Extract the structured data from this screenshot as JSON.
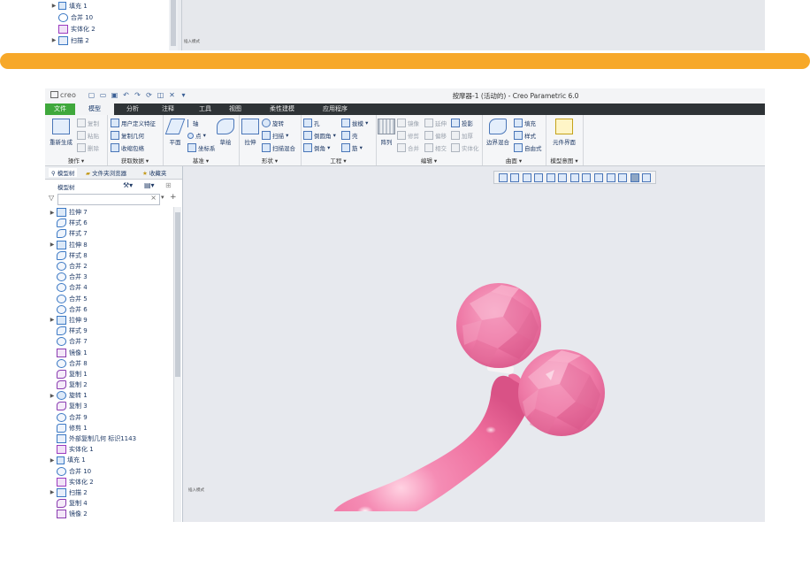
{
  "top_tree": {
    "items": [
      {
        "label": "填充 1",
        "expandable": true,
        "icon": "fill-icon"
      },
      {
        "label": "合并 10",
        "expandable": false,
        "icon": "merge-icon"
      },
      {
        "label": "实体化 2",
        "expandable": false,
        "icon": "solidify-icon"
      },
      {
        "label": "扫描 2",
        "expandable": true,
        "icon": "sweep-icon"
      }
    ],
    "status": "插入模式"
  },
  "app": {
    "logo": "creo",
    "window_title": "按摩器-1 (活动的) - Creo Parametric 6.0",
    "tabs": [
      {
        "label": "文件"
      },
      {
        "label": "模型"
      },
      {
        "label": "分析"
      },
      {
        "label": "注释"
      },
      {
        "label": "工具"
      },
      {
        "label": "视图"
      },
      {
        "label": "柔性建模"
      },
      {
        "label": "应用程序"
      }
    ],
    "ribbon": {
      "operations": {
        "label": "操作",
        "regenerate": "重新生成",
        "copy": "复制",
        "paste": "粘贴",
        "delete": "删除"
      },
      "get_data": {
        "label": "获取数据",
        "udf": "用户定义特征",
        "copy_geom": "复制几何",
        "shrinkwrap": "收缩包络"
      },
      "datum": {
        "label": "基准",
        "plane": "平面",
        "axis": "轴",
        "point": "点",
        "csys": "坐标系",
        "sketch": "草绘"
      },
      "shapes": {
        "label": "形状",
        "extrude": "拉伸",
        "revolve": "旋转",
        "sweep": "扫描",
        "swept_blend": "扫描混合"
      },
      "engineering": {
        "label": "工程",
        "hole": "孔",
        "round": "倒圆角",
        "chamfer": "倒角",
        "draft": "拔模",
        "shell": "壳",
        "rib": "筋"
      },
      "editing": {
        "label": "编辑",
        "pattern": "阵列",
        "mirror": "镜像",
        "extend": "延伸",
        "project": "投影",
        "trim": "修剪",
        "offset": "偏移",
        "thicken": "加厚",
        "merge": "合并",
        "intersect": "相交",
        "solidify": "实体化"
      },
      "surfaces": {
        "label": "曲面",
        "boundary_blend": "边界混合",
        "fill": "填充",
        "style": "样式",
        "freestyle": "自由式"
      },
      "model_intent": {
        "label": "模型意图",
        "component_interface": "元件界面"
      }
    },
    "panel": {
      "tabs": [
        "模型树",
        "文件夹浏览器",
        "收藏夹"
      ],
      "tree_title": "模型树",
      "items": [
        {
          "label": "拉伸 7",
          "expandable": true,
          "icon": "extrude-icon"
        },
        {
          "label": "样式 6",
          "expandable": false,
          "icon": "style-icon"
        },
        {
          "label": "样式 7",
          "expandable": false,
          "icon": "style-icon"
        },
        {
          "label": "拉伸 8",
          "expandable": true,
          "icon": "extrude-icon"
        },
        {
          "label": "样式 8",
          "expandable": false,
          "icon": "style-icon"
        },
        {
          "label": "合并 2",
          "expandable": false,
          "icon": "merge-icon"
        },
        {
          "label": "合并 3",
          "expandable": false,
          "icon": "merge-icon"
        },
        {
          "label": "合并 4",
          "expandable": false,
          "icon": "merge-icon"
        },
        {
          "label": "合并 5",
          "expandable": false,
          "icon": "merge-icon"
        },
        {
          "label": "合并 6",
          "expandable": false,
          "icon": "merge-icon"
        },
        {
          "label": "拉伸 9",
          "expandable": true,
          "icon": "extrude-icon"
        },
        {
          "label": "样式 9",
          "expandable": false,
          "icon": "style-icon"
        },
        {
          "label": "合并 7",
          "expandable": false,
          "icon": "merge-icon"
        },
        {
          "label": "镜像 1",
          "expandable": false,
          "icon": "mirror-icon"
        },
        {
          "label": "合并 8",
          "expandable": false,
          "icon": "merge-icon"
        },
        {
          "label": "复制 1",
          "expandable": false,
          "icon": "copy-icon"
        },
        {
          "label": "复制 2",
          "expandable": false,
          "icon": "copy-icon"
        },
        {
          "label": "旋转 1",
          "expandable": true,
          "icon": "revolve-icon"
        },
        {
          "label": "复制 3",
          "expandable": false,
          "icon": "copy-icon"
        },
        {
          "label": "合并 9",
          "expandable": false,
          "icon": "merge-icon"
        },
        {
          "label": "修剪 1",
          "expandable": false,
          "icon": "trim-icon"
        },
        {
          "label": "外部复制几何 标识1143",
          "expandable": false,
          "icon": "external-copy-icon"
        },
        {
          "label": "实体化 1",
          "expandable": false,
          "icon": "solidify-icon"
        },
        {
          "label": "填充 1",
          "expandable": true,
          "icon": "fill-icon"
        },
        {
          "label": "合并 10",
          "expandable": false,
          "icon": "merge-icon"
        },
        {
          "label": "实体化 2",
          "expandable": false,
          "icon": "solidify-icon"
        },
        {
          "label": "扫描 2",
          "expandable": true,
          "icon": "sweep-icon"
        },
        {
          "label": "复制 4",
          "expandable": false,
          "icon": "copy-icon"
        },
        {
          "label": "镜像 2",
          "expandable": false,
          "icon": "mirror-icon"
        }
      ]
    },
    "viewport": {
      "status": "插入模式",
      "model_color": "#f27aa6",
      "background": "#e7e9ee"
    }
  },
  "colors": {
    "accent_bar": "#f7a829",
    "file_tab": "#3fa83c",
    "ribbon_tabs_bg": "#2e3336"
  }
}
